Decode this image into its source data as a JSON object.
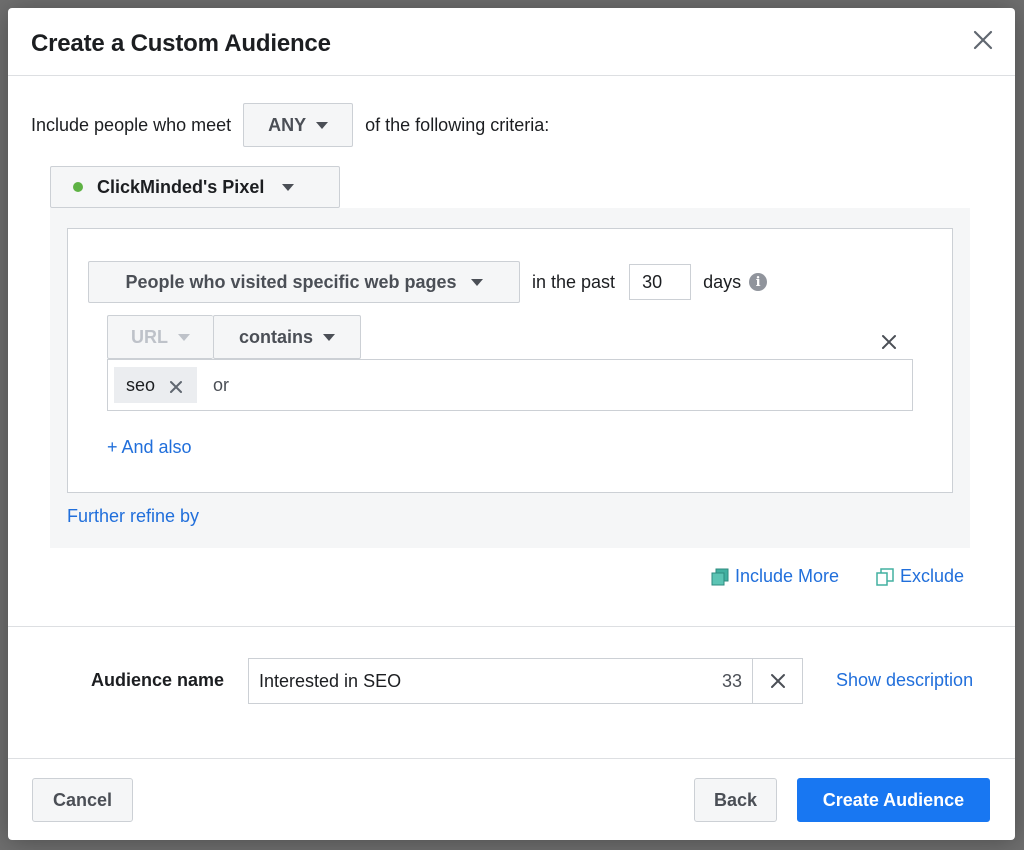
{
  "modal": {
    "title": "Create a Custom Audience"
  },
  "criteria": {
    "prefix": "Include people who meet",
    "match": "ANY",
    "suffix": "of the following criteria:"
  },
  "pixel": {
    "name": "ClickMinded's Pixel",
    "status_color": "#5eb244"
  },
  "rule": {
    "event": "People who visited specific web pages",
    "in_the_past": "in the past",
    "days_value": "30",
    "days_label": "days",
    "info_glyph": "i",
    "field": "URL",
    "operator": "contains",
    "tags": [
      "seo"
    ],
    "or_label": "or",
    "and_also": "+ And also"
  },
  "further_refine": "Further refine by",
  "actions": {
    "include_more": "Include More",
    "exclude": "Exclude"
  },
  "audience": {
    "label": "Audience name",
    "value": "Interested in SEO",
    "char_count": "33",
    "show_description": "Show description"
  },
  "footer": {
    "cancel": "Cancel",
    "back": "Back",
    "create": "Create Audience"
  },
  "colors": {
    "primary": "#1877f2",
    "link": "#216fdb"
  }
}
